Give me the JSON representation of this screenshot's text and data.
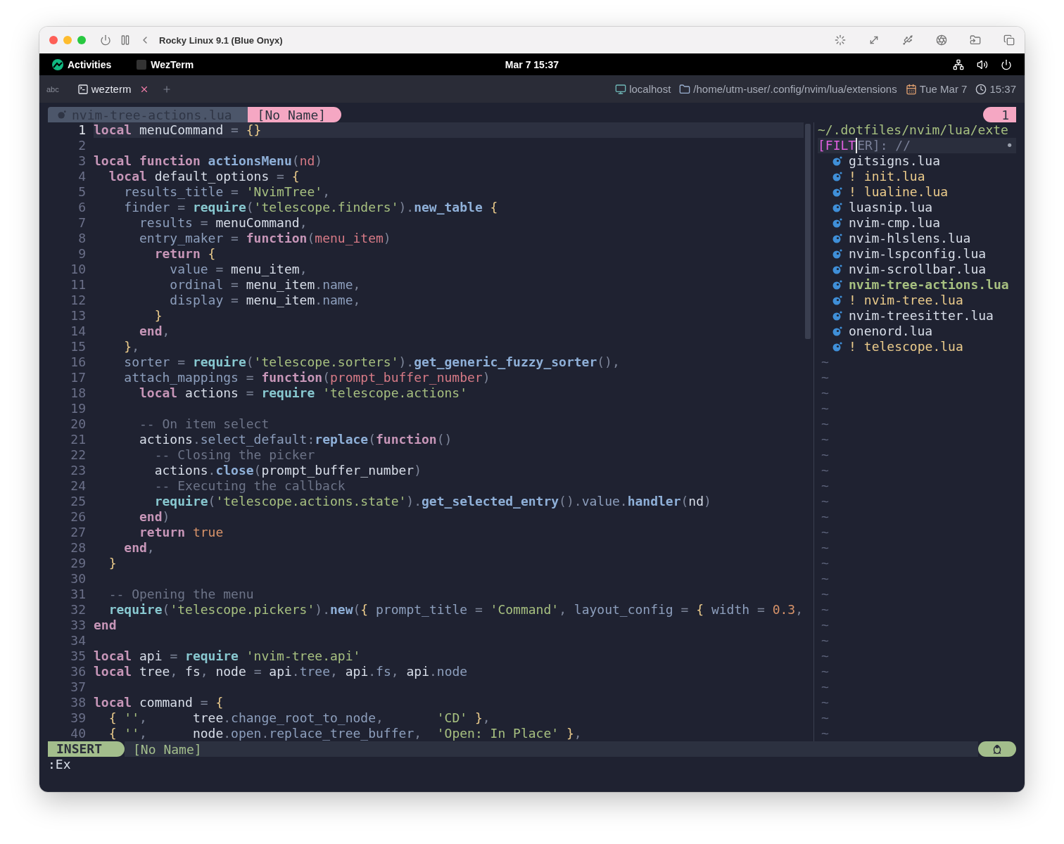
{
  "window": {
    "title": "Rocky Linux 9.1 (Blue Onyx)"
  },
  "gnome_bar": {
    "activities": "Activities",
    "app": "WezTerm",
    "clock": "Mar 7  15:37"
  },
  "tab_bar": {
    "input_method": "abc",
    "tabs": [
      {
        "title": "wezterm",
        "selected": true
      }
    ],
    "status": {
      "host": "localhost",
      "cwd": "/home/utm-user/.config/nvim/lua/extensions",
      "date": "Tue Mar 7",
      "time": "15:37"
    }
  },
  "bufferline": {
    "buffers": [
      {
        "name": "nvim-tree-actions.lua",
        "selected": false,
        "kind": "lua"
      },
      {
        "name": "[No Name]",
        "selected": true,
        "kind": "empty"
      }
    ],
    "tab_number": "1"
  },
  "editor": {
    "lines": [
      {
        "number": "1",
        "current": true,
        "tokens": [
          {
            "kind": "keyword",
            "text": "local"
          },
          {
            "kind": "plain",
            "text": " menuCommand"
          },
          {
            "kind": "operator",
            "text": " = "
          },
          {
            "kind": "brace",
            "text": "{}"
          }
        ]
      },
      {
        "number": "2",
        "current": false
      },
      {
        "number": "3",
        "current": false,
        "tokens": [
          {
            "kind": "keyword",
            "text": "local function "
          },
          {
            "kind": "function",
            "text": "actionsMenu"
          },
          {
            "kind": "operator",
            "text": "("
          },
          {
            "kind": "param",
            "text": "nd"
          },
          {
            "kind": "operator",
            "text": ")"
          }
        ]
      },
      {
        "number": "4",
        "current": false,
        "tokens": [
          {
            "kind": "keyword",
            "text": "  local"
          },
          {
            "kind": "plain",
            "text": " default_options"
          },
          {
            "kind": "operator",
            "text": " = "
          },
          {
            "kind": "brace",
            "text": "{"
          }
        ]
      },
      {
        "number": "5",
        "current": false,
        "tokens": [
          {
            "kind": "field",
            "text": "    results_title"
          },
          {
            "kind": "operator",
            "text": " = "
          },
          {
            "kind": "string",
            "text": "'NvimTree'"
          },
          {
            "kind": "operator",
            "text": ","
          }
        ]
      },
      {
        "number": "6",
        "current": false,
        "tokens": [
          {
            "kind": "field",
            "text": "    finder"
          },
          {
            "kind": "operator",
            "text": " = "
          },
          {
            "kind": "builtin",
            "text": "require"
          },
          {
            "kind": "operator",
            "text": "("
          },
          {
            "kind": "string",
            "text": "'telescope.finders'"
          },
          {
            "kind": "operator",
            "text": ")."
          },
          {
            "kind": "function",
            "text": "new_table"
          },
          {
            "kind": "brace",
            "text": " {"
          }
        ]
      },
      {
        "number": "7",
        "current": false,
        "tokens": [
          {
            "kind": "field",
            "text": "      results"
          },
          {
            "kind": "operator",
            "text": " = "
          },
          {
            "kind": "plain",
            "text": "menuCommand"
          },
          {
            "kind": "operator",
            "text": ","
          }
        ]
      },
      {
        "number": "8",
        "current": false,
        "tokens": [
          {
            "kind": "field",
            "text": "      entry_maker"
          },
          {
            "kind": "operator",
            "text": " = "
          },
          {
            "kind": "keyword",
            "text": "function"
          },
          {
            "kind": "operator",
            "text": "("
          },
          {
            "kind": "param",
            "text": "menu_item"
          },
          {
            "kind": "operator",
            "text": ")"
          }
        ]
      },
      {
        "number": "9",
        "current": false,
        "tokens": [
          {
            "kind": "keyword",
            "text": "        return"
          },
          {
            "kind": "brace",
            "text": " {"
          }
        ]
      },
      {
        "number": "10",
        "current": false,
        "tokens": [
          {
            "kind": "field",
            "text": "          value"
          },
          {
            "kind": "operator",
            "text": " = "
          },
          {
            "kind": "plain",
            "text": "menu_item"
          },
          {
            "kind": "operator",
            "text": ","
          }
        ]
      },
      {
        "number": "11",
        "current": false,
        "tokens": [
          {
            "kind": "field",
            "text": "          ordinal"
          },
          {
            "kind": "operator",
            "text": " = "
          },
          {
            "kind": "plain",
            "text": "menu_item"
          },
          {
            "kind": "operator",
            "text": "."
          },
          {
            "kind": "field",
            "text": "name"
          },
          {
            "kind": "operator",
            "text": ","
          }
        ]
      },
      {
        "number": "12",
        "current": false,
        "tokens": [
          {
            "kind": "field",
            "text": "          display"
          },
          {
            "kind": "operator",
            "text": " = "
          },
          {
            "kind": "plain",
            "text": "menu_item"
          },
          {
            "kind": "operator",
            "text": "."
          },
          {
            "kind": "field",
            "text": "name"
          },
          {
            "kind": "operator",
            "text": ","
          }
        ]
      },
      {
        "number": "13",
        "current": false,
        "tokens": [
          {
            "kind": "brace",
            "text": "        }"
          }
        ]
      },
      {
        "number": "14",
        "current": false,
        "tokens": [
          {
            "kind": "keyword",
            "text": "      end"
          },
          {
            "kind": "operator",
            "text": ","
          }
        ]
      },
      {
        "number": "15",
        "current": false,
        "tokens": [
          {
            "kind": "brace",
            "text": "    }"
          },
          {
            "kind": "operator",
            "text": ","
          }
        ]
      },
      {
        "number": "16",
        "current": false,
        "tokens": [
          {
            "kind": "field",
            "text": "    sorter"
          },
          {
            "kind": "operator",
            "text": " = "
          },
          {
            "kind": "builtin",
            "text": "require"
          },
          {
            "kind": "operator",
            "text": "("
          },
          {
            "kind": "string",
            "text": "'telescope.sorters'"
          },
          {
            "kind": "operator",
            "text": ")."
          },
          {
            "kind": "function",
            "text": "get_generic_fuzzy_sorter"
          },
          {
            "kind": "operator",
            "text": "(),"
          }
        ]
      },
      {
        "number": "17",
        "current": false,
        "tokens": [
          {
            "kind": "field",
            "text": "    attach_mappings"
          },
          {
            "kind": "operator",
            "text": " = "
          },
          {
            "kind": "keyword",
            "text": "function"
          },
          {
            "kind": "operator",
            "text": "("
          },
          {
            "kind": "param",
            "text": "prompt_buffer_number"
          },
          {
            "kind": "operator",
            "text": ")"
          }
        ]
      },
      {
        "number": "18",
        "current": false,
        "tokens": [
          {
            "kind": "keyword",
            "text": "      local"
          },
          {
            "kind": "plain",
            "text": " actions"
          },
          {
            "kind": "operator",
            "text": " = "
          },
          {
            "kind": "builtin",
            "text": "require"
          },
          {
            "kind": "string",
            "text": " 'telescope.actions'"
          }
        ]
      },
      {
        "number": "19",
        "current": false
      },
      {
        "number": "20",
        "current": false,
        "tokens": [
          {
            "kind": "comment",
            "text": "      -- On item select"
          }
        ]
      },
      {
        "number": "21",
        "current": false,
        "tokens": [
          {
            "kind": "plain",
            "text": "      actions"
          },
          {
            "kind": "operator",
            "text": "."
          },
          {
            "kind": "field",
            "text": "select_default"
          },
          {
            "kind": "operator",
            "text": ":"
          },
          {
            "kind": "function",
            "text": "replace"
          },
          {
            "kind": "operator",
            "text": "("
          },
          {
            "kind": "keyword",
            "text": "function"
          },
          {
            "kind": "operator",
            "text": "()"
          }
        ]
      },
      {
        "number": "22",
        "current": false,
        "tokens": [
          {
            "kind": "comment",
            "text": "        -- Closing the picker"
          }
        ]
      },
      {
        "number": "23",
        "current": false,
        "tokens": [
          {
            "kind": "plain",
            "text": "        actions"
          },
          {
            "kind": "operator",
            "text": "."
          },
          {
            "kind": "function",
            "text": "close"
          },
          {
            "kind": "operator",
            "text": "("
          },
          {
            "kind": "plain",
            "text": "prompt_buffer_number"
          },
          {
            "kind": "operator",
            "text": ")"
          }
        ]
      },
      {
        "number": "24",
        "current": false,
        "tokens": [
          {
            "kind": "comment",
            "text": "        -- Executing the callback"
          }
        ]
      },
      {
        "number": "25",
        "current": false,
        "tokens": [
          {
            "kind": "builtin",
            "text": "        require"
          },
          {
            "kind": "operator",
            "text": "("
          },
          {
            "kind": "string",
            "text": "'telescope.actions.state'"
          },
          {
            "kind": "operator",
            "text": ")."
          },
          {
            "kind": "function",
            "text": "get_selected_entry"
          },
          {
            "kind": "operator",
            "text": "()."
          },
          {
            "kind": "field",
            "text": "value"
          },
          {
            "kind": "operator",
            "text": "."
          },
          {
            "kind": "function",
            "text": "handler"
          },
          {
            "kind": "operator",
            "text": "("
          },
          {
            "kind": "plain",
            "text": "nd"
          },
          {
            "kind": "operator",
            "text": ")"
          }
        ]
      },
      {
        "number": "26",
        "current": false,
        "tokens": [
          {
            "kind": "keyword",
            "text": "      end"
          },
          {
            "kind": "operator",
            "text": ")"
          }
        ]
      },
      {
        "number": "27",
        "current": false,
        "tokens": [
          {
            "kind": "keyword",
            "text": "      return"
          },
          {
            "kind": "constant",
            "text": " true"
          }
        ]
      },
      {
        "number": "28",
        "current": false,
        "tokens": [
          {
            "kind": "keyword",
            "text": "    end"
          },
          {
            "kind": "operator",
            "text": ","
          }
        ]
      },
      {
        "number": "29",
        "current": false,
        "tokens": [
          {
            "kind": "brace",
            "text": "  }"
          }
        ]
      },
      {
        "number": "30",
        "current": false
      },
      {
        "number": "31",
        "current": false,
        "tokens": [
          {
            "kind": "comment",
            "text": "  -- Opening the menu"
          }
        ]
      },
      {
        "number": "32",
        "current": false,
        "tokens": [
          {
            "kind": "builtin",
            "text": "  require"
          },
          {
            "kind": "operator",
            "text": "("
          },
          {
            "kind": "string",
            "text": "'telescope.pickers'"
          },
          {
            "kind": "operator",
            "text": ")."
          },
          {
            "kind": "function",
            "text": "new"
          },
          {
            "kind": "operator",
            "text": "("
          },
          {
            "kind": "brace",
            "text": "{ "
          },
          {
            "kind": "field",
            "text": "prompt_title"
          },
          {
            "kind": "operator",
            "text": " = "
          },
          {
            "kind": "string",
            "text": "'Command'"
          },
          {
            "kind": "operator",
            "text": ", "
          },
          {
            "kind": "field",
            "text": "layout_config"
          },
          {
            "kind": "operator",
            "text": " = "
          },
          {
            "kind": "brace",
            "text": "{ "
          },
          {
            "kind": "field",
            "text": "width"
          },
          {
            "kind": "operator",
            "text": " = "
          },
          {
            "kind": "constant",
            "text": "0.3"
          },
          {
            "kind": "operator",
            "text": ","
          }
        ]
      },
      {
        "number": "33",
        "current": false,
        "tokens": [
          {
            "kind": "keyword",
            "text": "end"
          }
        ]
      },
      {
        "number": "34",
        "current": false
      },
      {
        "number": "35",
        "current": false,
        "tokens": [
          {
            "kind": "keyword",
            "text": "local"
          },
          {
            "kind": "plain",
            "text": " api"
          },
          {
            "kind": "operator",
            "text": " = "
          },
          {
            "kind": "builtin",
            "text": "require"
          },
          {
            "kind": "string",
            "text": " 'nvim-tree.api'"
          }
        ]
      },
      {
        "number": "36",
        "current": false,
        "tokens": [
          {
            "kind": "keyword",
            "text": "local"
          },
          {
            "kind": "plain",
            "text": " tree"
          },
          {
            "kind": "operator",
            "text": ", "
          },
          {
            "kind": "plain",
            "text": "fs"
          },
          {
            "kind": "operator",
            "text": ", "
          },
          {
            "kind": "plain",
            "text": "node"
          },
          {
            "kind": "operator",
            "text": " = "
          },
          {
            "kind": "plain",
            "text": "api"
          },
          {
            "kind": "operator",
            "text": "."
          },
          {
            "kind": "field",
            "text": "tree"
          },
          {
            "kind": "operator",
            "text": ", "
          },
          {
            "kind": "plain",
            "text": "api"
          },
          {
            "kind": "operator",
            "text": "."
          },
          {
            "kind": "field",
            "text": "fs"
          },
          {
            "kind": "operator",
            "text": ", "
          },
          {
            "kind": "plain",
            "text": "api"
          },
          {
            "kind": "operator",
            "text": "."
          },
          {
            "kind": "field",
            "text": "node"
          }
        ]
      },
      {
        "number": "37",
        "current": false
      },
      {
        "number": "38",
        "current": false,
        "tokens": [
          {
            "kind": "keyword",
            "text": "local"
          },
          {
            "kind": "plain",
            "text": " command"
          },
          {
            "kind": "operator",
            "text": " = "
          },
          {
            "kind": "brace",
            "text": "{"
          }
        ]
      },
      {
        "number": "39",
        "current": false,
        "tokens": [
          {
            "kind": "brace",
            "text": "  { "
          },
          {
            "kind": "string",
            "text": "''"
          },
          {
            "kind": "operator",
            "text": ","
          },
          {
            "kind": "plain",
            "text": "      tree"
          },
          {
            "kind": "operator",
            "text": "."
          },
          {
            "kind": "field",
            "text": "change_root_to_node"
          },
          {
            "kind": "operator",
            "text": ","
          },
          {
            "kind": "string",
            "text": "       'CD'"
          },
          {
            "kind": "brace",
            "text": " }"
          },
          {
            "kind": "operator",
            "text": ","
          }
        ]
      },
      {
        "number": "40",
        "current": false,
        "tokens": [
          {
            "kind": "brace",
            "text": "  { "
          },
          {
            "kind": "string",
            "text": "''"
          },
          {
            "kind": "operator",
            "text": ","
          },
          {
            "kind": "plain",
            "text": "      node"
          },
          {
            "kind": "operator",
            "text": "."
          },
          {
            "kind": "field",
            "text": "open"
          },
          {
            "kind": "operator",
            "text": "."
          },
          {
            "kind": "field",
            "text": "replace_tree_buffer"
          },
          {
            "kind": "operator",
            "text": ","
          },
          {
            "kind": "string",
            "text": "  'Open: In Place'"
          },
          {
            "kind": "brace",
            "text": " }"
          },
          {
            "kind": "operator",
            "text": ","
          }
        ]
      }
    ]
  },
  "file_tree": {
    "path": "~/.dotfiles/nvim/lua/exte",
    "filter": {
      "shown": "[FILT",
      "dimmed": "ER]: //",
      "indicator": "•"
    },
    "files": [
      {
        "name": "gitsigns.lua",
        "kind": "plain"
      },
      {
        "name": "init.lua",
        "kind": "flagged",
        "flag": "!"
      },
      {
        "name": "lualine.lua",
        "kind": "flagged",
        "flag": "!"
      },
      {
        "name": "luasnip.lua",
        "kind": "plain"
      },
      {
        "name": "nvim-cmp.lua",
        "kind": "plain"
      },
      {
        "name": "nvim-hlslens.lua",
        "kind": "plain"
      },
      {
        "name": "nvim-lspconfig.lua",
        "kind": "plain"
      },
      {
        "name": "nvim-scrollbar.lua",
        "kind": "plain"
      },
      {
        "name": "nvim-tree-actions.lua",
        "kind": "open"
      },
      {
        "name": "nvim-tree.lua",
        "kind": "flagged",
        "flag": "!"
      },
      {
        "name": "nvim-treesitter.lua",
        "kind": "plain"
      },
      {
        "name": "onenord.lua",
        "kind": "plain"
      },
      {
        "name": "telescope.lua",
        "kind": "flagged",
        "flag": "!"
      }
    ],
    "filler": [
      "~",
      "~",
      "~",
      "~",
      "~",
      "~",
      "~",
      "~",
      "~",
      "~",
      "~",
      "~",
      "~",
      "~",
      "~",
      "~",
      "~",
      "~",
      "~",
      "~",
      "~",
      "~",
      "~",
      "~",
      "~"
    ]
  },
  "statusline": {
    "mode": "INSERT",
    "file": "[No Name]"
  },
  "cmdline": ":Ex"
}
